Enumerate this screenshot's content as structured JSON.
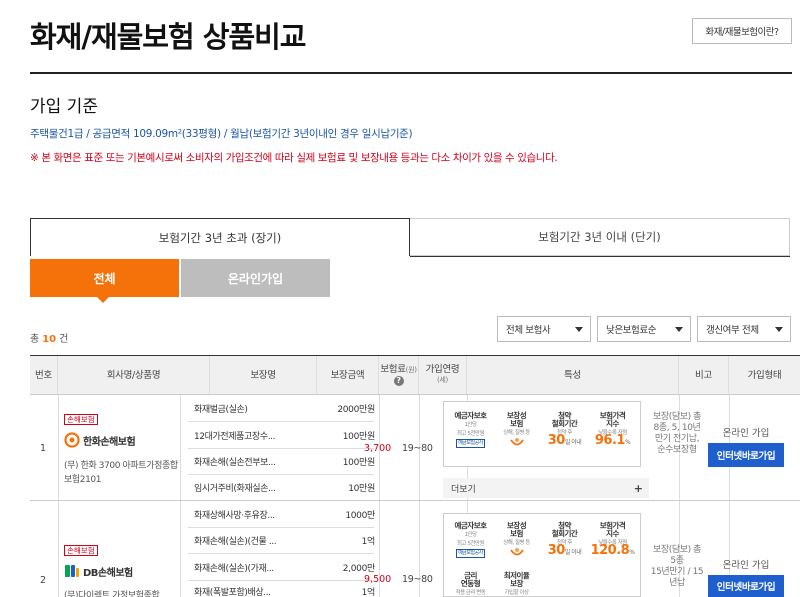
{
  "page": {
    "title": "화재/재물보험 상품비교",
    "help_button": "화재/재물보험이란?",
    "section_title": "가입 기준",
    "basis": "주택물건1급 / 공급면적 109.09m²(33평형) / 월납(보험기간 3년이내인 경우 일시납기준)",
    "notice": "※ 본 화면은 표준 또는 기본예시로써 소비자의 가입조건에 따라 실제 보험료 및 보장내용 등과는 다소 차이가 있을 수 있습니다."
  },
  "tabs": [
    {
      "label": "보험기간 3년 초과 (장기)",
      "active": true
    },
    {
      "label": "보험기간 3년 이내 (단기)",
      "active": false
    }
  ],
  "segments": [
    {
      "label": "전체",
      "active": true
    },
    {
      "label": "온라인가입",
      "active": false
    }
  ],
  "count": {
    "prefix": "총",
    "value": "10",
    "suffix": "건"
  },
  "filters": [
    "전체 보험사",
    "낮은보험료순",
    "갱신여부 전체"
  ],
  "table": {
    "headers": {
      "no": "번호",
      "company": "회사명/상품명",
      "coverage": "보장명",
      "amount": "보장금액",
      "premium": "보험료",
      "premium_unit": "(원)",
      "age": "가입연령",
      "age_unit": "(세)",
      "features": "특성",
      "remark": "비고",
      "join": "가입형태"
    },
    "rows": [
      {
        "no": "1",
        "badge": "손해보험",
        "company": "한화손해보험",
        "product_line1": "(무) 한화 3700 아파트가정종합",
        "product_line2": "보험2101",
        "coverages": [
          {
            "name": "화재벌금(실손)",
            "amount": "2000만원"
          },
          {
            "name": "12대가전제품고장수...",
            "amount": "100만원"
          },
          {
            "name": "화재손해(실손전부보...",
            "amount": "100만원"
          },
          {
            "name": "임시거주비(화재실손...",
            "amount": "10만원"
          }
        ],
        "premium": "3,700",
        "age": "19~80",
        "features": {
          "protect_title": "예금자보호",
          "protect_sub1": "1인당",
          "protect_sub2": "최고 5천만원",
          "protect_stamp": "예금보험공사",
          "coverage_title": "보장성",
          "coverage_title2": "보험",
          "coverage_sub": "상해, 질병 등",
          "cancel_title": "청약",
          "cancel_title2": "철회기간",
          "cancel_sub": "청약 후",
          "cancel_value": "30",
          "cancel_unit": "일 이내",
          "price_title": "보험가격",
          "price_title2": "지수",
          "price_sub": "낮을수록 저렴",
          "price_value": "96.1",
          "price_unit": "%"
        },
        "more": "더보기",
        "remark_line1": "보장(담보) 총",
        "remark_line2": "8종, 5, 10년",
        "remark_line3": "만기 전기납,",
        "remark_line4": "순수보장형",
        "join_text": "온라인 가입",
        "join_button": "인터넷바로가입"
      },
      {
        "no": "2",
        "badge": "손해보험",
        "company": "DB손해보험",
        "product_line1": "(무)다이렉트 가정보험종합",
        "coverages": [
          {
            "name": "화재상해사망·후유장...",
            "amount": "1000만"
          },
          {
            "name": "화재손해(실손)(건물 ...",
            "amount": "1억"
          },
          {
            "name": "화재손해(실손)(가재...",
            "amount": "2,000만"
          },
          {
            "name": "화재(폭발포함)배상...",
            "amount": "1억"
          }
        ],
        "premium": "9,500",
        "age": "19~80",
        "features": {
          "protect_title": "예금자보호",
          "protect_sub1": "1인당",
          "protect_sub2": "최고 5천만원",
          "protect_stamp": "예금보험공사",
          "coverage_title": "보장성",
          "coverage_title2": "보험",
          "coverage_sub": "상해, 질병 등",
          "cancel_title": "청약",
          "cancel_title2": "철회기간",
          "cancel_sub": "청약 후",
          "cancel_value": "30",
          "cancel_unit": "일 이내",
          "price_title": "보험가격",
          "price_title2": "지수",
          "price_sub": "낮을수록 저렴",
          "price_value": "120.8",
          "price_unit": "%",
          "rate_title": "금리",
          "rate_title2": "연동형",
          "rate_sub": "적용 금리 변동",
          "min_rate_title": "최저이율",
          "min_rate_title2": "보장",
          "min_rate_sub": "가입할 이상"
        },
        "remark_line1": "보장(담보) 총",
        "remark_line2": "5종",
        "remark_line3": "15년만기 / 15",
        "remark_line4": "년납",
        "join_text": "온라인 가입",
        "join_button": "인터넷바로가입"
      }
    ]
  },
  "colors": {
    "accent_orange": "#f5720a",
    "accent_blue": "#1e5fcd",
    "notice_red": "#d0021b",
    "link_blue": "#1a55a5"
  }
}
